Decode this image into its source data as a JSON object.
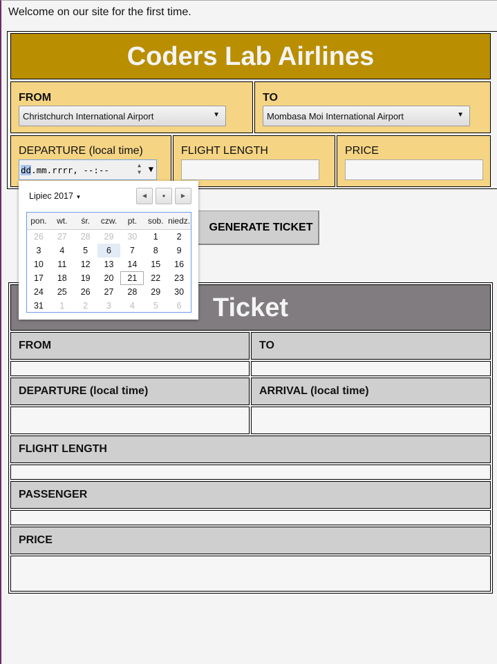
{
  "welcome": "Welcome on our site for the first time.",
  "form": {
    "title": "Coders Lab Airlines",
    "from_label": "FROM",
    "from_value": "Christchurch International Airport",
    "to_label": "TO",
    "to_value": "Mombasa Moi International Airport",
    "departure_label": "DEPARTURE (local time)",
    "departure_placeholder_day": "dd",
    "departure_placeholder_rest": ".mm.rrrr, --:--",
    "flight_length_label": "FLIGHT LENGTH",
    "price_label": "PRICE",
    "generate_label": "GENERATE TICKET"
  },
  "calendar": {
    "month": "Lipiec 2017",
    "weekdays": [
      "pon.",
      "wt.",
      "śr.",
      "czw.",
      "pt.",
      "sob.",
      "niedz."
    ],
    "weeks": [
      [
        "26",
        "27",
        "28",
        "29",
        "30",
        "1",
        "2"
      ],
      [
        "3",
        "4",
        "5",
        "6",
        "7",
        "8",
        "9"
      ],
      [
        "10",
        "11",
        "12",
        "13",
        "14",
        "15",
        "16"
      ],
      [
        "17",
        "18",
        "19",
        "20",
        "21",
        "22",
        "23"
      ],
      [
        "24",
        "25",
        "26",
        "27",
        "28",
        "29",
        "30"
      ],
      [
        "31",
        "1",
        "2",
        "3",
        "4",
        "5",
        "6"
      ]
    ],
    "highlighted": "6",
    "today": "21"
  },
  "ticket": {
    "title": "Ticket",
    "from_label": "FROM",
    "to_label": "TO",
    "departure_label": "DEPARTURE (local time)",
    "arrival_label": "ARRIVAL (local time)",
    "flight_length_label": "FLIGHT LENGTH",
    "passenger_label": "PASSENGER",
    "price_label": "PRICE"
  },
  "colors": {
    "header": "#b98e00",
    "form_cell": "#f5d484",
    "ticket_header": "#807c7f",
    "ticket_label": "#cfcfcf"
  }
}
